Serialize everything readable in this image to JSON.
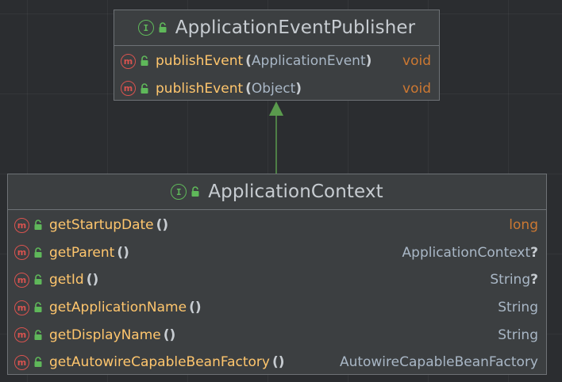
{
  "diagram": {
    "colors": {
      "background": "#2b2d30",
      "node_fill": "#3c3f41",
      "node_border": "#6e7276",
      "method_name": "#ffc66d",
      "type_text": "#a9b7c6",
      "keyword_type": "#cc7832",
      "interface_icon": "#5fb85a",
      "method_icon": "#d9534f",
      "arrow": "#5a9b4d"
    },
    "parent": {
      "name": "ApplicationEventPublisher",
      "kind_icon": "interface-icon",
      "visibility_icon": "public-lock-icon",
      "methods": [
        {
          "name": "publishEvent",
          "params": "ApplicationEvent",
          "returns": "void"
        },
        {
          "name": "publishEvent",
          "params": "Object",
          "returns": "void"
        }
      ]
    },
    "child": {
      "name": "ApplicationContext",
      "kind_icon": "interface-icon",
      "visibility_icon": "public-lock-icon",
      "methods": [
        {
          "name": "getStartupDate",
          "params": "",
          "returns": "long",
          "nullable": ""
        },
        {
          "name": "getParent",
          "params": "",
          "returns": "ApplicationContext",
          "nullable": "?"
        },
        {
          "name": "getId",
          "params": "",
          "returns": "String",
          "nullable": "?"
        },
        {
          "name": "getApplicationName",
          "params": "",
          "returns": "String",
          "nullable": ""
        },
        {
          "name": "getDisplayName",
          "params": "",
          "returns": "String",
          "nullable": ""
        },
        {
          "name": "getAutowireCapableBeanFactory",
          "params": "",
          "returns": "AutowireCapableBeanFactory",
          "nullable": ""
        }
      ]
    },
    "relation": {
      "type": "extends",
      "from": "ApplicationContext",
      "to": "ApplicationEventPublisher"
    }
  }
}
